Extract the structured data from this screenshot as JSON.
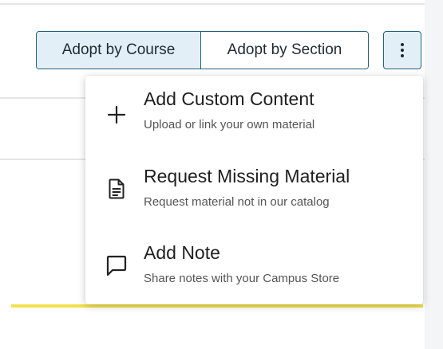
{
  "toolbar": {
    "adopt_by_course_label": "Adopt by Course",
    "adopt_by_section_label": "Adopt by Section",
    "more_icon": "kebab-vertical-icon"
  },
  "menu": {
    "items": [
      {
        "title": "Add Custom Content",
        "subtitle": "Upload or link your own material",
        "icon": "plus-icon"
      },
      {
        "title": "Request Missing Material",
        "subtitle": "Request material not in our catalog",
        "icon": "document-icon"
      },
      {
        "title": "Add Note",
        "subtitle": "Share notes with your Campus Store",
        "icon": "comment-icon"
      }
    ]
  },
  "colors": {
    "accent_border": "#23627b",
    "selected_segment": "#e3eff6",
    "highlight_bar": "#f3e14d"
  }
}
